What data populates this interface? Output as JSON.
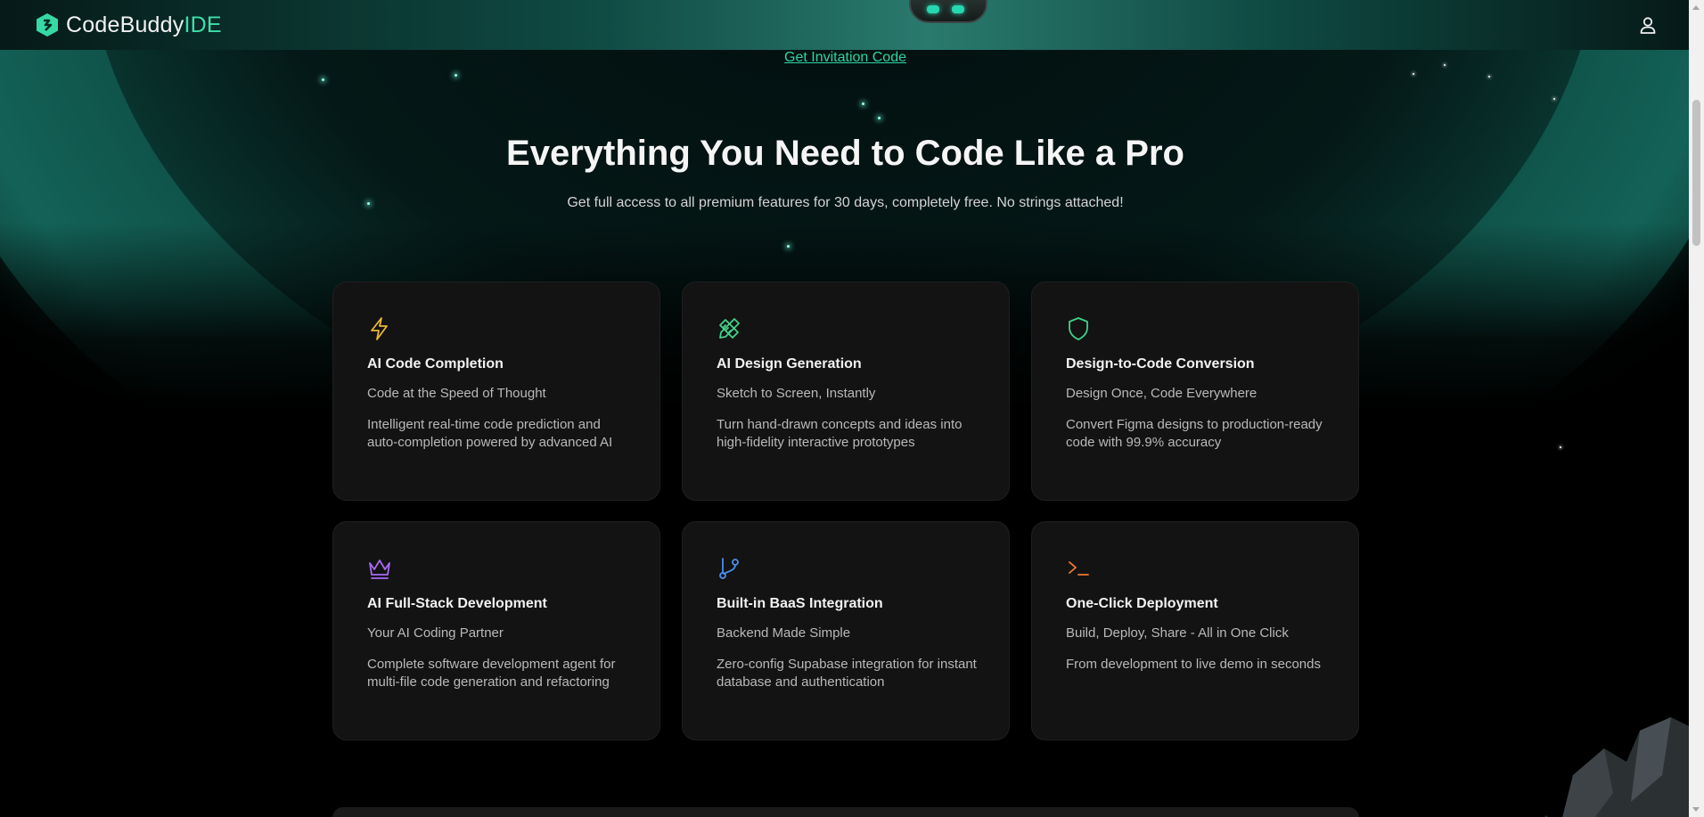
{
  "header": {
    "logo_main": "CodeBuddy",
    "logo_accent": "IDE",
    "user_icon": "user-icon"
  },
  "hero": {
    "invite_link": "Get Invitation Code",
    "headline": "Everything You Need to Code Like a Pro",
    "subhead": "Get full access to all premium features for 30 days, completely free. No strings attached!"
  },
  "features": [
    {
      "icon": "lightning-icon",
      "icon_color": "#e8b931",
      "title": "AI Code Completion",
      "tagline": "Code at the Speed of Thought",
      "description": "Intelligent real-time code prediction and auto-completion powered by advanced AI"
    },
    {
      "icon": "pencil-ruler-icon",
      "icon_color": "#3fd38a",
      "title": "AI Design Generation",
      "tagline": "Sketch to Screen, Instantly",
      "description": "Turn hand-drawn concepts and ideas into high-fidelity interactive prototypes"
    },
    {
      "icon": "shield-icon",
      "icon_color": "#3fd38a",
      "title": "Design-to-Code Conversion",
      "tagline": "Design Once, Code Everywhere",
      "description": "Convert Figma designs to production-ready code with 99.9% accuracy"
    },
    {
      "icon": "crown-icon",
      "icon_color": "#a86bf0",
      "title": "AI Full-Stack Development",
      "tagline": "Your AI Coding Partner",
      "description": "Complete software development agent for multi-file code generation and refactoring"
    },
    {
      "icon": "git-branch-icon",
      "icon_color": "#4a8ff0",
      "title": "Built-in BaaS Integration",
      "tagline": "Backend Made Simple",
      "description": "Zero-config Supabase integration for instant database and authentication"
    },
    {
      "icon": "terminal-icon",
      "icon_color": "#f07a2e",
      "title": "One-Click Deployment",
      "tagline": "Build, Deploy, Share - All in One Click",
      "description": "From development to live demo in seconds"
    }
  ],
  "colors": {
    "accent": "#3de0a8",
    "link": "#2fd4a2",
    "card_bg": "#131313"
  }
}
